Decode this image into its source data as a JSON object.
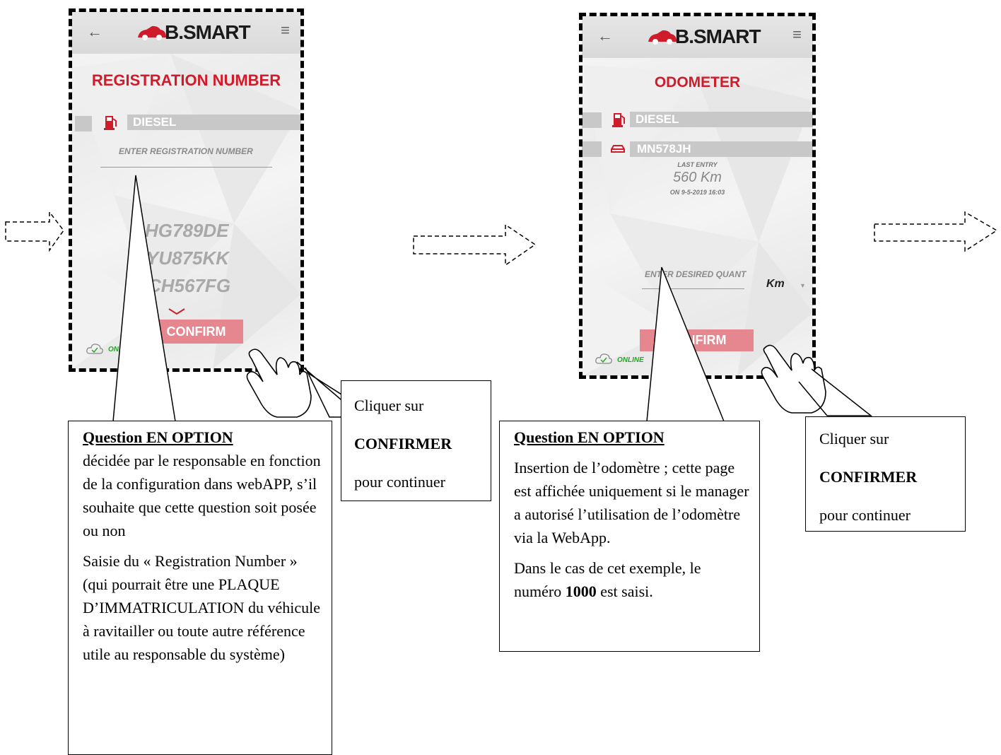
{
  "screen1": {
    "title": "REGISTRATION NUMBER",
    "fuel": "DIESEL",
    "input_placeholder": "ENTER REGISTRATION NUMBER",
    "options": [
      "HG789DE",
      "YU875KK",
      "CH567FG"
    ],
    "confirm": "CONFIRM",
    "status": "ONLINE"
  },
  "screen2": {
    "title": "ODOMETER",
    "fuel": "DIESEL",
    "plate": "MN578JH",
    "last_entry_label": "LAST ENTRY",
    "last_entry_value": "560 Km",
    "last_entry_date": "ON 9-5-2019 16:03",
    "input_placeholder": "ENTER DESIRED QUANT",
    "unit": "Km",
    "confirm": "CONFIRM",
    "status": "ONLINE"
  },
  "brand": "B.SMART",
  "icons": [
    "back-arrow-icon",
    "menu-icon",
    "fuel-pump-icon",
    "car-icon",
    "cloud-check-icon",
    "chevron-down-icon",
    "hand-pointer-icon"
  ],
  "colors": {
    "accent": "#d01c2a",
    "confirm": "#e6868e",
    "online": "#28a428"
  },
  "callout1": {
    "heading": "Question EN OPTION",
    "para1": "décidée par le responsable en fonction de la configuration dans webAPP, s’il souhaite que cette question soit posée ou non",
    "para2": "Saisie du « Registration Number » (qui pourrait être une PLAQUE D’IMMATRICULATION du véhicule à ravitailler ou toute autre référence utile au responsable du système)"
  },
  "callout2": {
    "line1": "Cliquer sur",
    "line2": "CONFIRMER",
    "line3": "pour continuer"
  },
  "callout3": {
    "heading": "Question EN OPTION",
    "para1": "Insertion de l’odomètre ; cette page est affichée uniquement si le manager a autorisé l’utilisation de l’odomètre via la WebApp.",
    "para2_a": "Dans le cas de cet exemple, le numéro ",
    "para2_b": "1000",
    "para2_c": " est saisi."
  },
  "callout4": {
    "line1": "Cliquer sur",
    "line2": "CONFIRMER",
    "line3": "pour continuer"
  }
}
